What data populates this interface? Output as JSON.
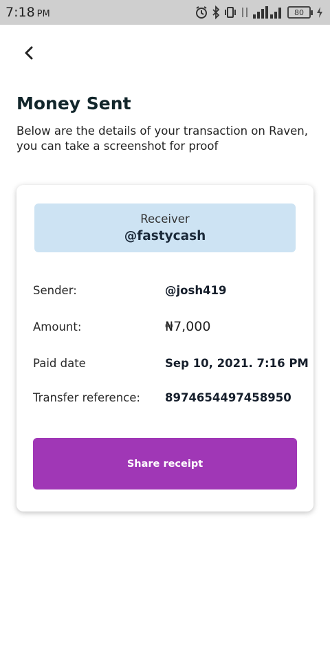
{
  "status_bar": {
    "time": "7:18",
    "ampm": "PM",
    "battery": "80"
  },
  "page": {
    "title": "Money Sent",
    "subtitle": "Below are the details of your transaction on Raven, you can take a screenshot for proof"
  },
  "receipt": {
    "receiver_label": "Receiver",
    "receiver_value": "@fastycash",
    "rows": [
      {
        "label": "Sender:",
        "value": "@josh419"
      },
      {
        "label": "Amount:",
        "value": "₦7,000"
      },
      {
        "label": "Paid date",
        "value": "Sep 10, 2021. 7:16 PM"
      },
      {
        "label": "Transfer reference:",
        "value": "8974654497458950"
      }
    ],
    "share_label": "Share receipt"
  },
  "colors": {
    "accent": "#a037b6",
    "receiver_bg": "#cde3f3",
    "title": "#12262b"
  },
  "icons": [
    "alarm-icon",
    "bluetooth-icon",
    "vibrate-icon",
    "data-transfer-icon",
    "signal-icon",
    "battery-icon",
    "charging-icon",
    "back-arrow-icon"
  ]
}
